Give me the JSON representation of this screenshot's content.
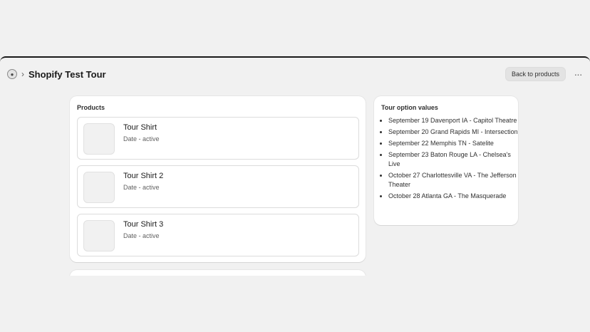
{
  "header": {
    "title": "Shopify Test Tour",
    "back_button": "Back to products",
    "more_label": "···"
  },
  "products_card": {
    "title": "Products",
    "items": [
      {
        "name": "Tour Shirt",
        "subtitle": "Date - active"
      },
      {
        "name": "Tour Shirt 2",
        "subtitle": "Date - active"
      },
      {
        "name": "Tour Shirt 3",
        "subtitle": "Date - active"
      }
    ]
  },
  "options_card": {
    "title": "Tour option values",
    "values": [
      "September 19 Davenport IA - Capitol Theatre",
      "September 20 Grand Rapids MI - Intersection",
      "September 22 Memphis TN - Satelite",
      "September 23 Baton Rouge LA - Chelsea's Live",
      "October 27 Charlottesville VA - The Jefferson Theater",
      "October 28 Atlanta GA - The Masquerade"
    ]
  }
}
